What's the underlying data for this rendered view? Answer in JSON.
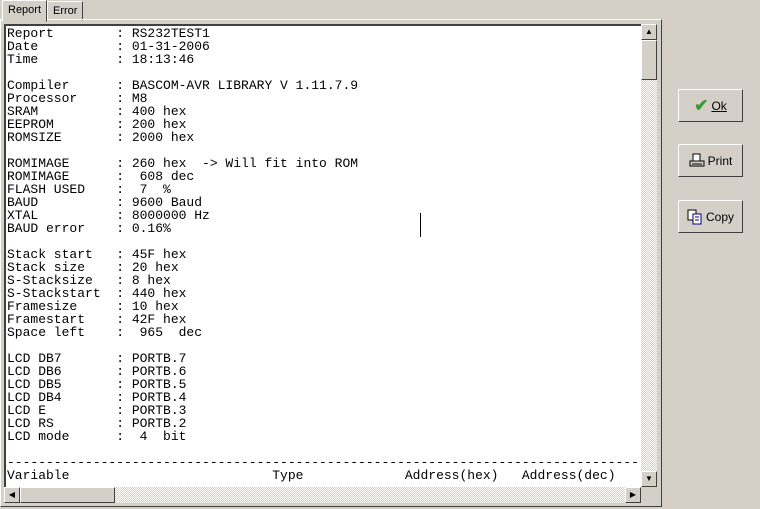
{
  "tabs": [
    {
      "label": "Report",
      "active": true
    },
    {
      "label": "Error",
      "active": false
    }
  ],
  "report_lines": [
    "Report        : RS232TEST1",
    "Date          : 01-31-2006",
    "Time          : 18:13:46",
    "",
    "Compiler      : BASCOM-AVR LIBRARY V 1.11.7.9",
    "Processor     : M8",
    "SRAM          : 400 hex",
    "EEPROM        : 200 hex",
    "ROMSIZE       : 2000 hex",
    "",
    "ROMIMAGE      : 260 hex  -> Will fit into ROM",
    "ROMIMAGE      :  608 dec",
    "FLASH USED    :  7  %",
    "BAUD          : 9600 Baud",
    "XTAL          : 8000000 Hz",
    "BAUD error    : 0.16%",
    "",
    "Stack start   : 45F hex",
    "Stack size    : 20 hex",
    "S-Stacksize   : 8 hex",
    "S-Stackstart  : 440 hex",
    "Framesize     : 10 hex",
    "Framestart    : 42F hex",
    "Space left    :  965  dec",
    "",
    "LCD DB7       : PORTB.7",
    "LCD DB6       : PORTB.6",
    "LCD DB5       : PORTB.5",
    "LCD DB4       : PORTB.4",
    "LCD E         : PORTB.3",
    "LCD RS        : PORTB.2",
    "LCD mode      :  4  bit",
    "",
    "--------------------------------------------------------------------------------------",
    "Variable                          Type             Address(hex)   Address(dec)"
  ],
  "buttons": {
    "ok": "Ok",
    "print": "Print",
    "copy": "Copy"
  },
  "colors": {
    "ok_check": "#3a9a3a",
    "face": "#d4d0c8"
  }
}
